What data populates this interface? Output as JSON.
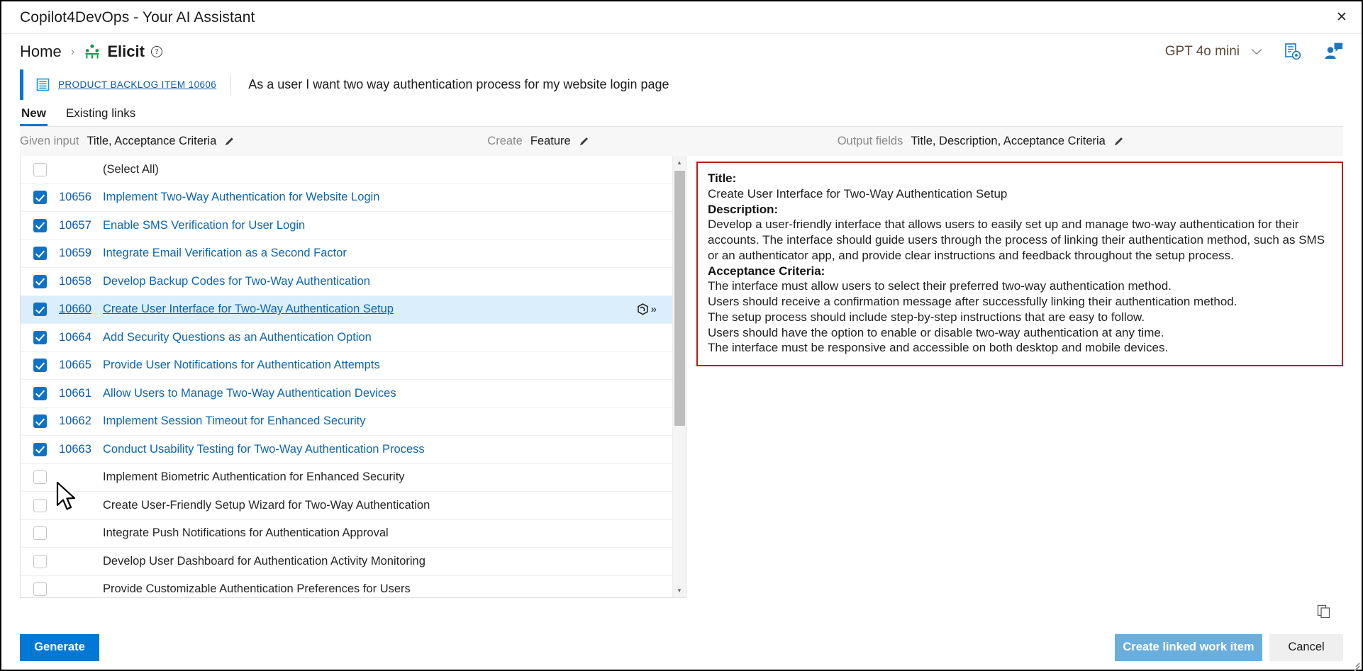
{
  "window": {
    "title": "Copilot4DevOps - Your AI Assistant",
    "close_icon": "close-icon"
  },
  "breadcrumb": {
    "home": "Home",
    "separator": "›",
    "current": "Elicit",
    "current_icon": "elicit-people-icon",
    "help_icon": "?"
  },
  "header": {
    "model": "GPT 4o mini",
    "chevron": "⌄",
    "settings_icon": "document-settings-icon",
    "account_icon": "user-chat-icon"
  },
  "work_item": {
    "type_icon": "backlog-item-icon",
    "id_label": "PRODUCT BACKLOG ITEM 10606",
    "title": "As a user I want two way authentication process for my website login page"
  },
  "tabs": [
    {
      "label": "New",
      "active": true
    },
    {
      "label": "Existing links",
      "active": false
    }
  ],
  "fieldbar": {
    "given_input_label": "Given input",
    "given_input_value": "Title, Acceptance Criteria",
    "create_label": "Create",
    "create_value": "Feature",
    "output_fields_label": "Output fields",
    "output_fields_value": "Title, Description, Acceptance Criteria",
    "edit_icon": "pencil-icon"
  },
  "list": {
    "select_all_label": "(Select All)",
    "rows": [
      {
        "id": "10656",
        "title": "Implement Two-Way Authentication for Website Login",
        "checked": true,
        "selected": false
      },
      {
        "id": "10657",
        "title": "Enable SMS Verification for User Login",
        "checked": true,
        "selected": false
      },
      {
        "id": "10659",
        "title": "Integrate Email Verification as a Second Factor",
        "checked": true,
        "selected": false
      },
      {
        "id": "10658",
        "title": "Develop Backup Codes for Two-Way Authentication",
        "checked": true,
        "selected": false
      },
      {
        "id": "10660",
        "title": "Create User Interface for Two-Way Authentication Setup",
        "checked": true,
        "selected": true
      },
      {
        "id": "10664",
        "title": "Add Security Questions as an Authentication Option",
        "checked": true,
        "selected": false
      },
      {
        "id": "10665",
        "title": "Provide User Notifications for Authentication Attempts",
        "checked": true,
        "selected": false
      },
      {
        "id": "10661",
        "title": "Allow Users to Manage Two-Way Authentication Devices",
        "checked": true,
        "selected": false
      },
      {
        "id": "10662",
        "title": "Implement Session Timeout for Enhanced Security",
        "checked": true,
        "selected": false
      },
      {
        "id": "10663",
        "title": "Conduct Usability Testing for Two-Way Authentication Process",
        "checked": true,
        "selected": false
      },
      {
        "id": "",
        "title": "Implement Biometric Authentication for Enhanced Security",
        "checked": false,
        "selected": false
      },
      {
        "id": "",
        "title": "Create User-Friendly Setup Wizard for Two-Way Authentication",
        "checked": false,
        "selected": false
      },
      {
        "id": "",
        "title": "Integrate Push Notifications for Authentication Approval",
        "checked": false,
        "selected": false
      },
      {
        "id": "",
        "title": "Develop User Dashboard for Authentication Activity Monitoring",
        "checked": false,
        "selected": false
      },
      {
        "id": "",
        "title": "Provide Customizable Authentication Preferences for Users",
        "checked": false,
        "selected": false
      }
    ],
    "row_action_icon": "copilot-expand-icon",
    "scrollbar": {
      "up_icon": "▲",
      "down_icon": "▼"
    }
  },
  "detail": {
    "title_label": "Title:",
    "title_value": "Create User Interface for Two-Way Authentication Setup",
    "description_label": "Description:",
    "description_lines": [
      "Develop a user-friendly interface that allows users to easily set up and manage two-way authentication for their",
      "accounts. The interface should guide users through the process of linking their authentication method, such as SMS",
      "or an authenticator app, and provide clear instructions and feedback throughout the setup process."
    ],
    "acceptance_label": "Acceptance Criteria:",
    "acceptance_lines": [
      "The interface must allow users to select their preferred two-way authentication method.",
      "Users should receive a confirmation message after successfully linking their authentication method.",
      "The setup process should include step-by-step instructions that are easy to follow.",
      "Users should have the option to enable or disable two-way authentication at any time.",
      "The interface must be responsive and accessible on both desktop and mobile devices."
    ],
    "highlight_color": "#b71c1c"
  },
  "footer": {
    "copy_icon": "copy-icon",
    "generate_label": "Generate",
    "create_linked_label": "Create linked work item",
    "cancel_label": "Cancel",
    "accent_color": "#0078d4",
    "disabled_button_color": "#6aaede"
  },
  "cursor": {
    "icon": "mouse-pointer-icon"
  }
}
